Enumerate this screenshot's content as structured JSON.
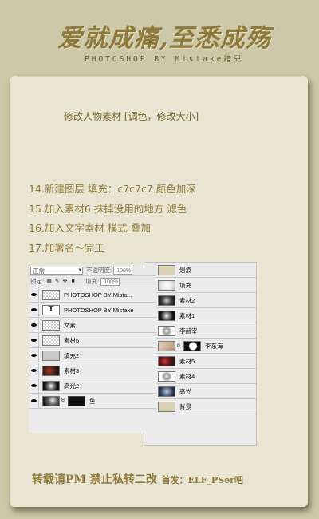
{
  "header": {
    "title": "爱就成痛,至悉成殇",
    "subtitle": "PHOTOSHOP BY Mistake錯兒"
  },
  "intro": "修改人物素材 [调色，修改大小]",
  "steps": [
    "14.新建图层 填充：c7c7c7 颜色加深",
    "15.加入素材6 抹掉没用的地方 滤色",
    "16.加入文字素材 模式 叠加",
    "17.加署名～完工"
  ],
  "left_panel": {
    "blend_mode": "正常",
    "opacity_label": "不透明度:",
    "opacity_value": "100%",
    "lock_label": "锁定:",
    "fill_label": "填充:",
    "fill_value": "100%",
    "layers": [
      {
        "name": "PHOTOSHOP BY Mista...",
        "thumb": "trans"
      },
      {
        "name": "PHOTOSHOP BY Mistake",
        "thumb": "text"
      },
      {
        "name": "文素",
        "thumb": "trans"
      },
      {
        "name": "素材6",
        "thumb": "trans"
      },
      {
        "name": "填充2",
        "thumb": "grey"
      },
      {
        "name": "素材3",
        "thumb": "photo1"
      },
      {
        "name": "高光2",
        "thumb": "photo2"
      },
      {
        "name": "鱼",
        "thumb": "photo3",
        "mask": true
      }
    ]
  },
  "right_panel": {
    "layers": [
      {
        "name": "划痕",
        "thumb": "beige"
      },
      {
        "name": "填充",
        "thumb": "photo7"
      },
      {
        "name": "素材2",
        "thumb": "photo4"
      },
      {
        "name": "素材1",
        "thumb": "photo2"
      },
      {
        "name": "李赫宰",
        "thumb": "photo5"
      },
      {
        "name": "李东海",
        "thumb": "face",
        "mask": true
      },
      {
        "name": "素材5",
        "thumb": "photo6"
      },
      {
        "name": "素材4",
        "thumb": "photo5"
      },
      {
        "name": "高光",
        "thumb": "photo8"
      },
      {
        "name": "背景",
        "thumb": "beige"
      }
    ]
  },
  "footer": {
    "notice": "转载请PM 禁止私转二改",
    "source": "首发：ELF_PSer吧"
  },
  "colors": {
    "page_bg": "#cdc8a8",
    "card_bg": "#e8e5d2",
    "accent_text": "#8f7a3c"
  }
}
